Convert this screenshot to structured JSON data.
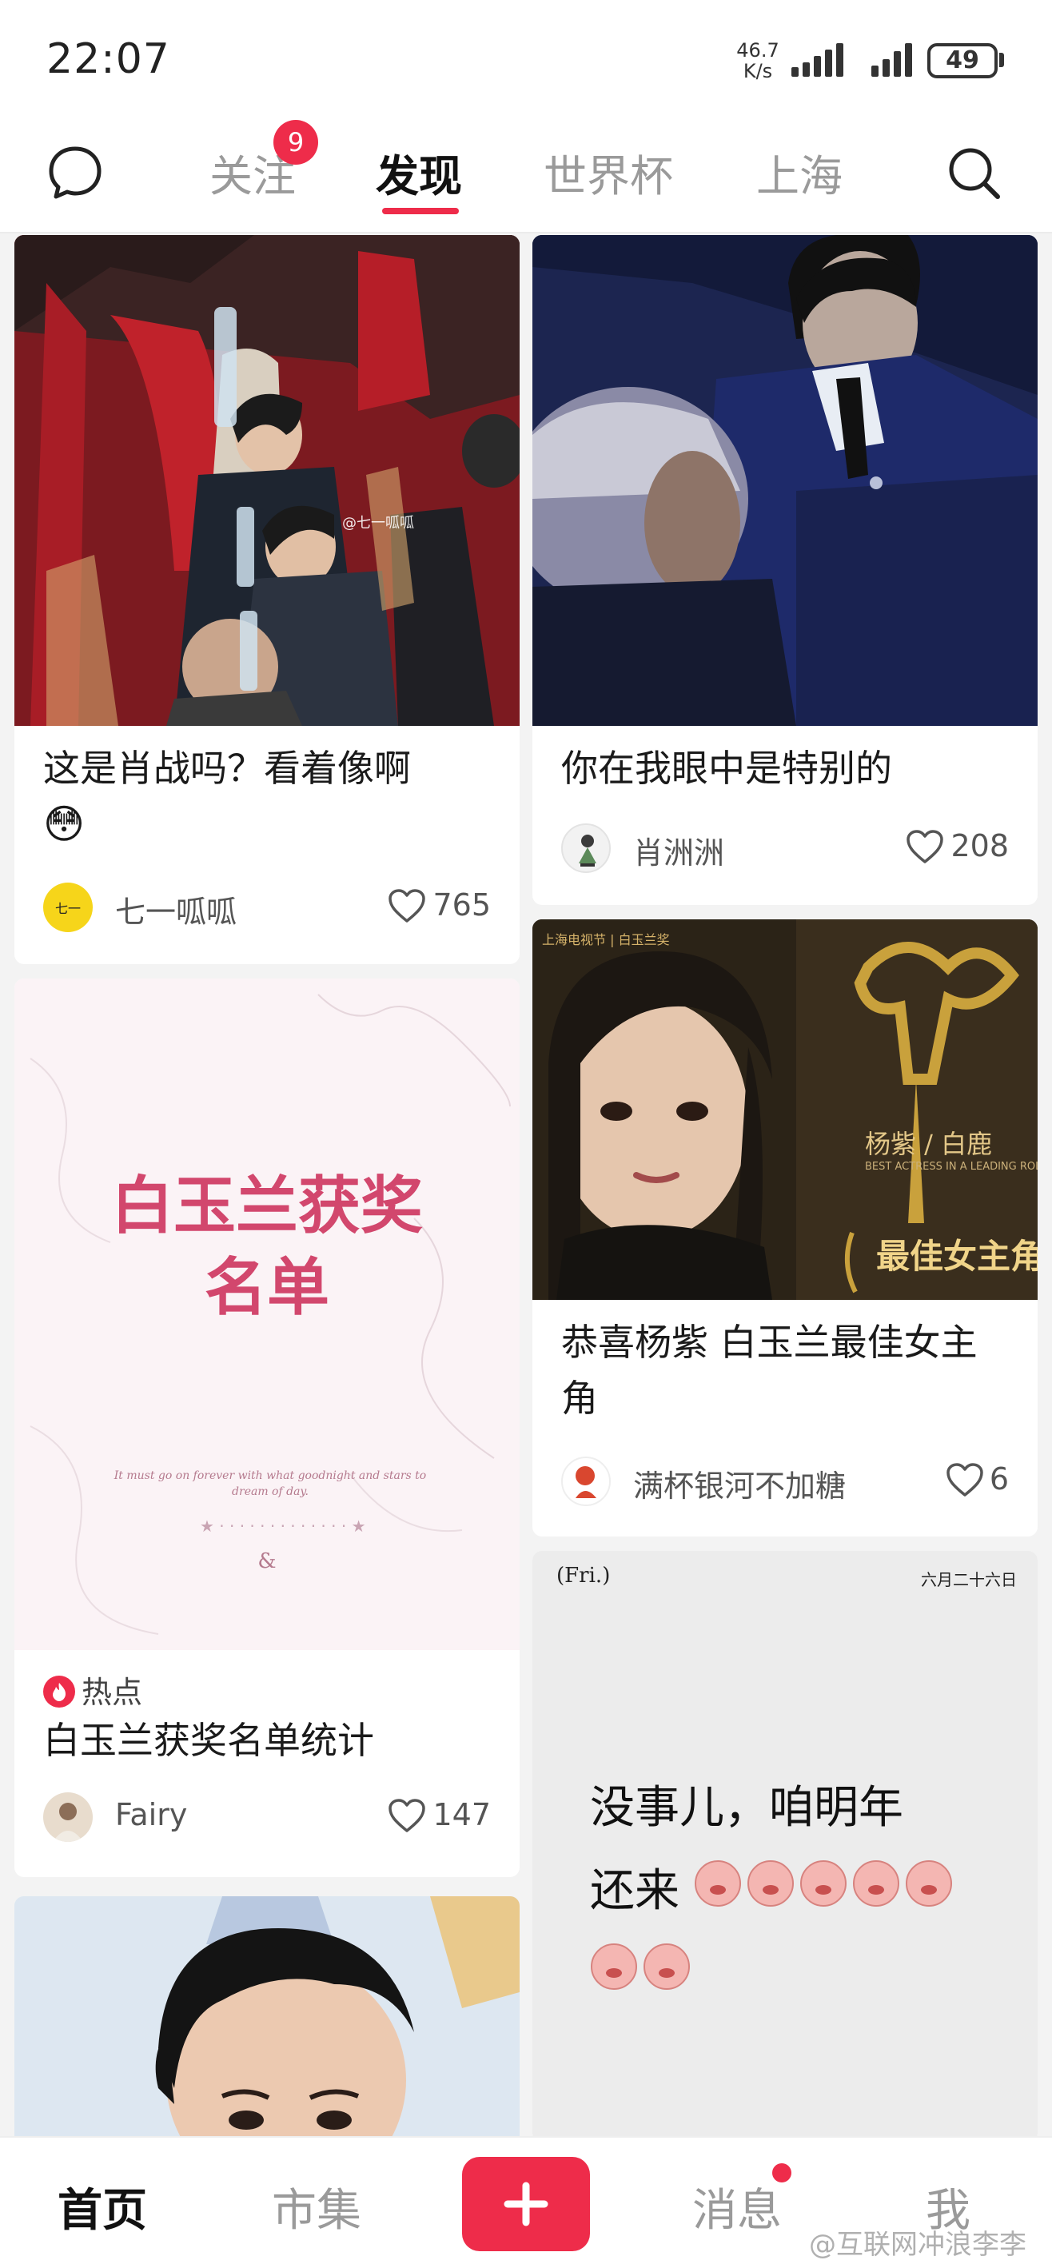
{
  "status": {
    "time": "22:07",
    "net_speed": "46.7",
    "net_unit": "K/s",
    "battery": "49"
  },
  "top_nav": {
    "tabs": [
      "关注",
      "发现",
      "世界杯",
      "上海"
    ],
    "active_tab": "发现",
    "follow_badge": "9"
  },
  "feed": {
    "left": [
      {
        "title": "这是肖战吗？看着像啊",
        "title_emoji": "😳",
        "author": "七一呱呱",
        "likes": "765",
        "image_watermark": "@七一呱呱"
      },
      {
        "poster_line1": "白玉兰获奖",
        "poster_line2": "名单",
        "poster_script": "It must go on forever with what goodnight and stars to dream of day.",
        "poster_amp": "&",
        "tag": "热点",
        "title": "白玉兰获奖名单统计",
        "author": "Fairy",
        "likes": "147"
      },
      {
        "title": ""
      }
    ],
    "right": [
      {
        "title": "你在我眼中是特别的",
        "author": "肖洲洲",
        "likes": "208"
      },
      {
        "image_logo": "上海电视节 | 白玉兰奖",
        "image_name": "杨紫 / 白鹿",
        "image_subtitle": "BEST ACTRESS IN A LEADING ROLE",
        "image_award": "最佳女主角",
        "title": "恭喜杨紫 白玉兰最佳女主角",
        "author": "满杯银河不加糖",
        "likes": "6"
      },
      {
        "header_left": "(Fri.)",
        "header_right": "六月二十六日",
        "text_line1": "没事儿，咱明年",
        "text_line2": "还来"
      }
    ]
  },
  "bottom_nav": {
    "home": "首页",
    "market": "市集",
    "messages": "消息",
    "me": "我"
  },
  "watermark": "@互联网冲浪李李",
  "colors": {
    "accent": "#ee2c4a",
    "text": "#222222",
    "muted": "#9a9a9a"
  }
}
